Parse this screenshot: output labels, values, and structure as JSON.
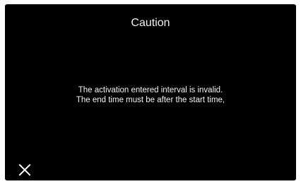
{
  "dialog": {
    "title": "Caution",
    "message_line1": "The activation entered interval is invalid.",
    "message_line2": "The end time must be after the start time,",
    "close_icon": "close-icon",
    "background": "#000000",
    "text_color": "#f2f2f2"
  }
}
